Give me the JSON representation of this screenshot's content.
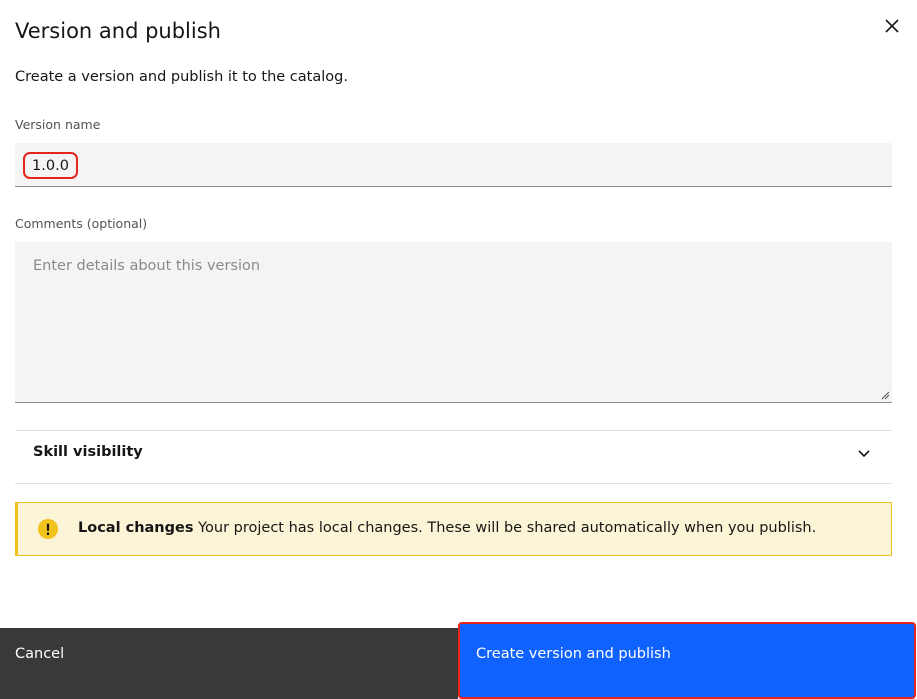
{
  "dialog": {
    "title": "Version and publish",
    "subtitle": "Create a version and publish it to the catalog."
  },
  "version_name": {
    "label": "Version name",
    "value": "1.0.0"
  },
  "comments": {
    "label": "Comments (optional)",
    "placeholder": "Enter details about this version"
  },
  "skill_visibility": {
    "title": "Skill visibility"
  },
  "notice": {
    "title": "Local changes",
    "message": "Your project has local changes. These will be shared automatically when you publish."
  },
  "footer": {
    "cancel_label": "Cancel",
    "primary_label": "Create version and publish"
  },
  "colors": {
    "primary": "#0f62fe",
    "secondary": "#393939",
    "warning": "#f1c21b",
    "highlight": "#e8241f"
  },
  "icons": [
    "close-icon",
    "chevron-down-icon",
    "warning-icon",
    "resize-handle-icon"
  ]
}
